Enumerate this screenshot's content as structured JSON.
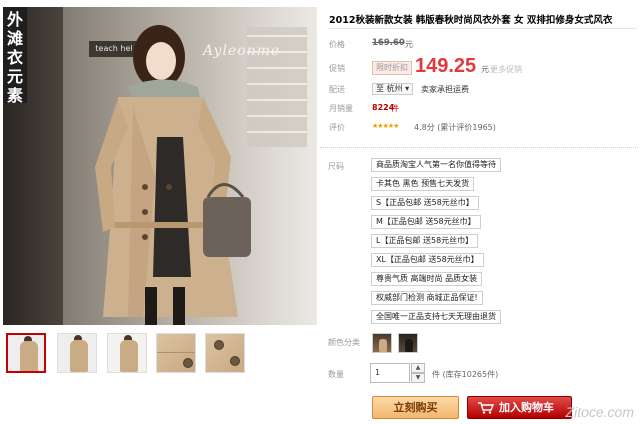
{
  "brand_banner": [
    "外",
    "滩",
    "衣",
    "元",
    "素"
  ],
  "photo": {
    "sign": "teach hel",
    "script_logo": "Ayleonme"
  },
  "thumbnails": [
    {
      "kind": "model-front"
    },
    {
      "kind": "model-side"
    },
    {
      "kind": "model-back"
    },
    {
      "kind": "fabric-closeup"
    },
    {
      "kind": "button-closeup"
    }
  ],
  "product": {
    "title": "2012秋装新款女装 韩版春秋时尚风衣外套 女 双排扣修身女式风衣",
    "price_label": "价格",
    "original_price": "169.60",
    "price_unit": "元",
    "promo_label": "促销",
    "promo_tag": "限时折扣",
    "promo_price": "149.25",
    "promo_unit": "元",
    "promo_more": "更多促销",
    "delivery_label": "配送",
    "ship_from": "至 杭州 ▾",
    "ship_note": "卖家承担运费",
    "sales_label": "月销量",
    "sales_count": "8224",
    "sales_unit": "件",
    "rating_label": "评价",
    "stars": "★★★★★",
    "rating_text": "4.8分 (累计评价1965)"
  },
  "sku": {
    "size_label": "尺码",
    "options": [
      "商品质淘宝人气第一名你值得等待",
      "卡其色 黑色 预售七天发货",
      "S【正品包邮 送58元丝巾】",
      "M【正品包邮 送58元丝巾】",
      "L【正品包邮 送58元丝巾】",
      "XL【正品包邮 送58元丝巾】",
      "尊贵气质 高端时尚 品质女装",
      "权威部门检测 商城正品保证!",
      "全国唯一正品支持七天无理由退货"
    ],
    "color_label": "颜色分类",
    "quantity_label": "数量",
    "quantity_value": "1",
    "stock_text": "件 (库存10265件)"
  },
  "actions": {
    "buy_now": "立刻购买",
    "add_to_cart": "加入购物车"
  },
  "watermark": "Zitoce.com",
  "colors": {
    "accent_red": "#c40000",
    "price_red": "#e4393c",
    "buy_orange": "#f3b66f"
  }
}
